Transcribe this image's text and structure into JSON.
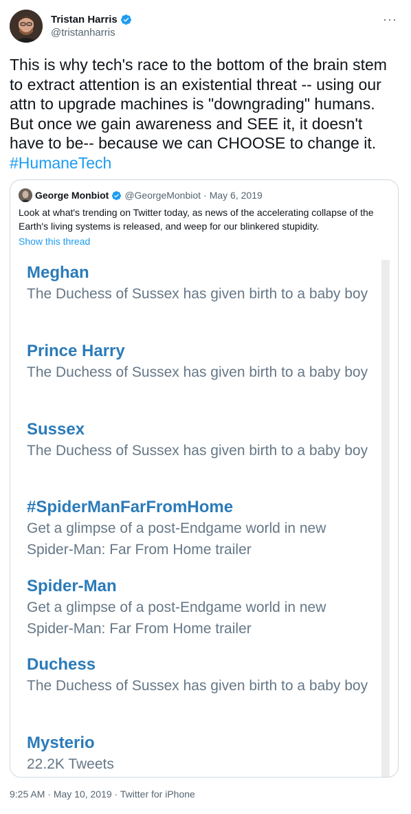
{
  "author": {
    "name": "Tristan Harris",
    "handle": "@tristanharris"
  },
  "tweet": {
    "text": "This is why tech's race to the bottom of the brain stem to extract attention is an existential threat -- using our attn to upgrade machines is \"downgrading\" humans. But once we gain awareness and SEE it, it doesn't have to be-- because we can CHOOSE to change it.",
    "hashtag": "#HumaneTech"
  },
  "quoted": {
    "name": "George Monbiot",
    "handle": "@GeorgeMonbiot",
    "separator": "·",
    "date": "May 6, 2019",
    "text": "Look at what's trending on Twitter today, as news of the accelerating collapse of the Earth's living systems is released, and weep for our blinkered stupidity.",
    "show_thread": "Show this thread",
    "trends": [
      {
        "title": "Meghan",
        "desc": "The Duchess of Sussex has given birth to a baby boy"
      },
      {
        "title": "Prince Harry",
        "desc": "The Duchess of Sussex has given birth to a baby boy"
      },
      {
        "title": "Sussex",
        "desc": "The Duchess of Sussex has given birth to a baby boy"
      },
      {
        "title": "#SpiderManFarFromHome",
        "desc": "Get a glimpse of a post-Endgame world in new Spider-Man: Far From Home trailer"
      },
      {
        "title": "Spider-Man",
        "desc": "Get a glimpse of a post-Endgame world in new Spider-Man: Far From Home trailer"
      },
      {
        "title": "Duchess",
        "desc": "The Duchess of Sussex has given birth to a baby boy"
      },
      {
        "title": "Mysterio",
        "desc": "22.2K Tweets"
      }
    ]
  },
  "footer": {
    "time": "9:25 AM",
    "separator": "·",
    "date": "May 10, 2019",
    "source": "Twitter for iPhone"
  },
  "icons": {
    "verified": "verified-badge-icon",
    "more": "more-options-icon"
  },
  "colors": {
    "link": "#1d9bf0",
    "trend_title": "#2b7bb9",
    "trend_desc": "#657786",
    "secondary_text": "#536471"
  }
}
